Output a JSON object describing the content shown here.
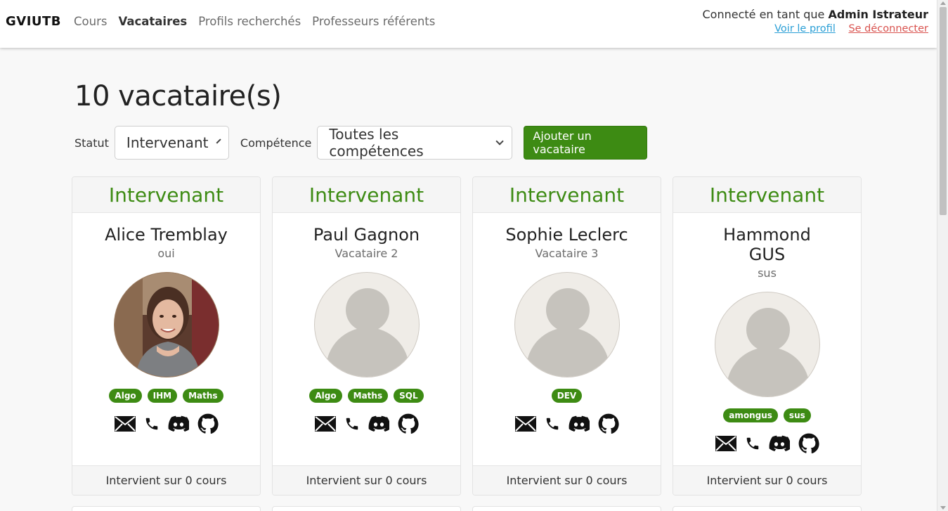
{
  "navbar": {
    "brand": "GVIUTB",
    "links": [
      {
        "label": "Cours",
        "active": false
      },
      {
        "label": "Vacataires",
        "active": true
      },
      {
        "label": "Profils recherchés",
        "active": false
      },
      {
        "label": "Professeurs référents",
        "active": false
      }
    ],
    "connected_prefix": "Connecté en tant que",
    "user_name": "Admin Istrateur",
    "profile_link": "Voir le profil",
    "logout_link": "Se déconnecter"
  },
  "page": {
    "title": "10 vacataire(s)"
  },
  "filters": {
    "statut_label": "Statut",
    "statut_value": "Intervenant",
    "competence_label": "Compétence",
    "competence_value": "Toutes les compétences",
    "add_button": "Ajouter un vacataire"
  },
  "cards": [
    {
      "status": "Intervenant",
      "name": "Alice Tremblay",
      "subtitle": "oui",
      "has_photo": true,
      "skills": [
        "Algo",
        "IHM",
        "Maths"
      ],
      "footer": "Intervient sur 0 cours"
    },
    {
      "status": "Intervenant",
      "name": "Paul Gagnon",
      "subtitle": "Vacataire 2",
      "has_photo": false,
      "skills": [
        "Algo",
        "Maths",
        "SQL"
      ],
      "footer": "Intervient sur 0 cours"
    },
    {
      "status": "Intervenant",
      "name": "Sophie Leclerc",
      "subtitle": "Vacataire 3",
      "has_photo": false,
      "skills": [
        "DEV"
      ],
      "footer": "Intervient sur 0 cours"
    },
    {
      "status": "Intervenant",
      "name_line1": "Hammond",
      "name_line2": "GUS",
      "subtitle": "sus",
      "has_photo": false,
      "skills": [
        "amongus",
        "sus"
      ],
      "footer": "Intervient sur 0 cours"
    }
  ],
  "icons": {
    "email": "envelope-icon",
    "phone": "phone-icon",
    "discord": "discord-icon",
    "github": "github-icon"
  },
  "colors": {
    "accent_green": "#3d8b13",
    "link_blue": "#2a9fd6",
    "link_red": "#d9534f"
  }
}
